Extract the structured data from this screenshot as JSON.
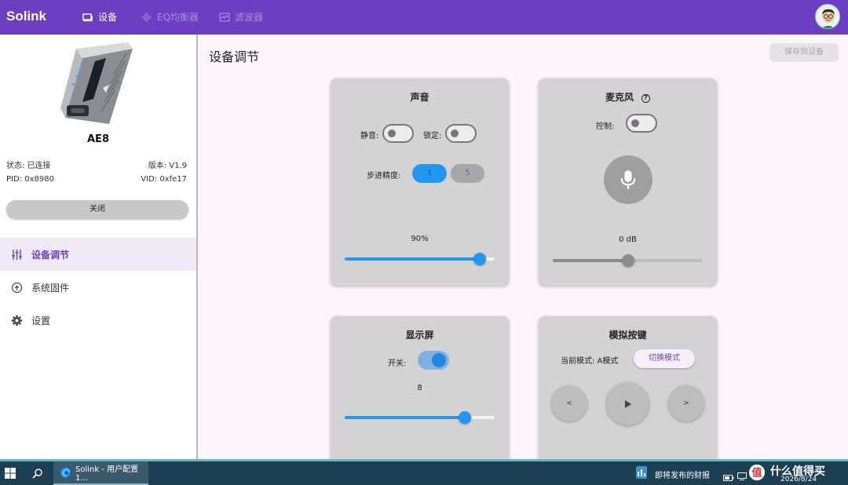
{
  "appbar": {
    "brand": "Solink",
    "tabs": [
      {
        "label": "设备",
        "icon": "device-icon",
        "active": true
      },
      {
        "label": "EQ均衡器",
        "icon": "equalizer-icon",
        "active": false
      },
      {
        "label": "滤波器",
        "icon": "filter-wave-icon",
        "active": false
      }
    ],
    "avatar_icon": "user-avatar"
  },
  "sidebar": {
    "device_name": "AE8",
    "status_label": "状态: 已连接",
    "version_label": "版本: V1.9",
    "pid_label": "PID: 0x8980",
    "vid_label": "VID: 0xfe17",
    "close_label": "关闭",
    "items": [
      {
        "label": "设备调节",
        "icon": "sliders-icon",
        "active": true
      },
      {
        "label": "系统固件",
        "icon": "upload-circle-icon",
        "active": false
      },
      {
        "label": "设置",
        "icon": "gear-icon",
        "active": false
      }
    ]
  },
  "main": {
    "title": "设备调节",
    "save_label": "保存到设备",
    "sound": {
      "title": "声音",
      "mute_label": "静音:",
      "mute_on": false,
      "lock_label": "锁定:",
      "lock_on": false,
      "step_label": "步进精度:",
      "step_options": [
        "1",
        "5"
      ],
      "step_selected": "1",
      "volume_text": "90%",
      "volume_level": 0.9
    },
    "mic": {
      "title": "麦克风",
      "help_icon": "help-circle-icon",
      "control_label": "控制:",
      "control_on": false,
      "mic_icon": "microphone-icon",
      "gain_text": "0 dB",
      "gain_level": 0.5
    },
    "display": {
      "title": "显示屏",
      "switch_label": "开关:",
      "switch_on": true,
      "brightness_text": "8",
      "brightness_level": 0.8
    },
    "buttons": {
      "title": "模拟按键",
      "mode_label": "当前模式: A模式",
      "switch_mode_label": "切换模式",
      "prev_label": "<",
      "play_icon": "play-icon",
      "next_label": ">"
    }
  },
  "taskbar": {
    "app_label": "Solink - 用户配置 1...",
    "news_label": "即将发布的财报",
    "time_text": "2026/8/24",
    "watermark_text": "什么值得买",
    "colors": {
      "bar": "#1d3f52",
      "accent": "#5fb7c9"
    }
  },
  "colors": {
    "primary": "#6c3fc2",
    "accent": "#2196f3",
    "card": "#d3d3d3"
  }
}
